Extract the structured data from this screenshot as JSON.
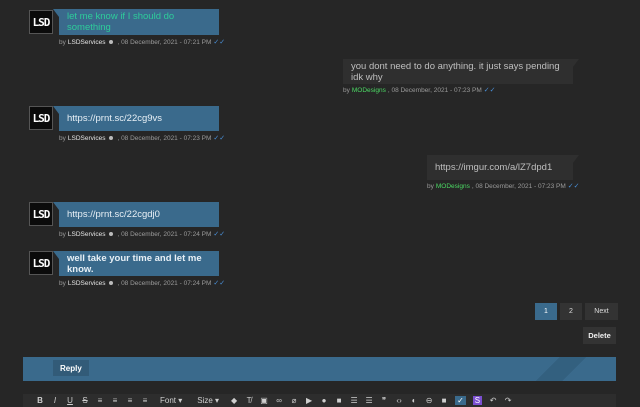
{
  "messages": [
    {
      "avatar": "LSD",
      "text": "let me know if I should do something",
      "by": "by",
      "user": "LSDServices",
      "date": ", 08 December, 2021 - 07:21 PM",
      "side": "left",
      "text_color": "#2ecc9a"
    },
    {
      "text": "you dont need to do anything. it just says pending idk why",
      "by": "by",
      "user": "MODesigns",
      "date": ", 08 December, 2021 - 07:23 PM",
      "side": "right"
    },
    {
      "avatar": "LSD",
      "text": "https://prnt.sc/22cg9vs",
      "by": "by",
      "user": "LSDServices",
      "date": ", 08 December, 2021 - 07:23 PM",
      "side": "left"
    },
    {
      "text": "https://imgur.com/a/lZ7dpd1",
      "by": "by",
      "user": "MODesigns",
      "date": ", 08 December, 2021 - 07:23 PM",
      "side": "right"
    },
    {
      "avatar": "LSD",
      "text": "https://prnt.sc/22cgdj0",
      "by": "by",
      "user": "LSDServices",
      "date": ", 08 December, 2021 - 07:24 PM",
      "side": "left"
    },
    {
      "avatar": "LSD",
      "text": "well take your time and let me know.",
      "by": "by",
      "user": "LSDServices",
      "date": ", 08 December, 2021 - 07:24 PM",
      "side": "left"
    }
  ],
  "pagination": {
    "page1": "1",
    "page2": "2",
    "next": "Next",
    "current": 1
  },
  "delete_label": "Delete",
  "reply_label": "Reply",
  "toolbar": {
    "bold": "B",
    "italic": "I",
    "underline": "U",
    "strike": "S",
    "font": "Font",
    "size": "Size"
  },
  "colors": {
    "accent": "#3a6a8c",
    "mod_name": "#4cd964",
    "read_check": "#4a90d9"
  }
}
